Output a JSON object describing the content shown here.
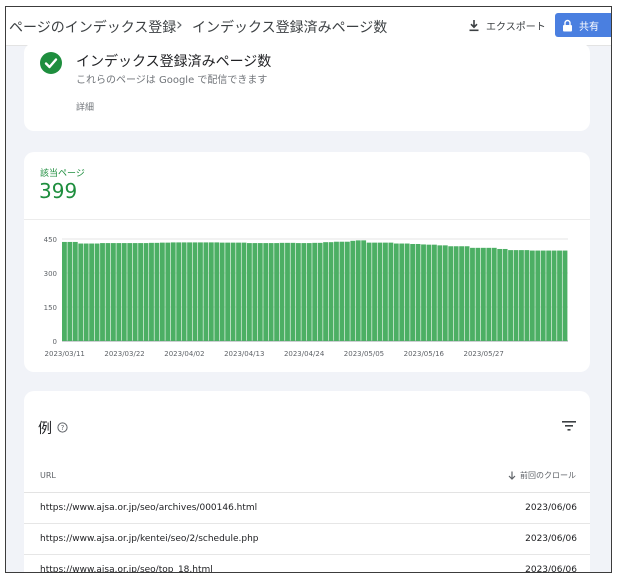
{
  "header": {
    "breadcrumb_parent": "ページのインデックス登録",
    "breadcrumb_separator": "›",
    "breadcrumb_current": "インデックス登録済みページ数",
    "export_label": "エクスポート",
    "share_label": "共有"
  },
  "status_card": {
    "title": "インデックス登録済みページ数",
    "subtitle": "これらのページは Google で配信できます",
    "details_link": "詳細"
  },
  "summary": {
    "label": "該当ページ",
    "value": "399"
  },
  "chart_data": {
    "type": "bar",
    "title": "",
    "xlabel": "",
    "ylabel": "",
    "ylim": [
      0,
      450
    ],
    "yticks": [
      0,
      150,
      300,
      450
    ],
    "ytick_labels": [
      "0",
      "150",
      "300",
      "450"
    ],
    "xtick_labels": [
      "2023/03/11",
      "2023/03/22",
      "2023/04/02",
      "2023/04/13",
      "2023/04/24",
      "2023/05/05",
      "2023/05/16",
      "2023/05/27"
    ],
    "color": "#4caf64",
    "values": [
      437,
      437,
      437,
      430,
      430,
      430,
      430,
      432,
      432,
      432,
      432,
      432,
      432,
      432,
      432,
      432,
      433,
      433,
      434,
      434,
      435,
      435,
      435,
      435,
      435,
      435,
      435,
      435,
      435,
      434,
      434,
      434,
      434,
      434,
      432,
      432,
      432,
      432,
      432,
      432,
      433,
      433,
      433,
      432,
      432,
      432,
      433,
      433,
      436,
      436,
      438,
      438,
      438,
      442,
      444,
      444,
      434,
      434,
      434,
      434,
      434,
      430,
      430,
      430,
      428,
      428,
      426,
      425,
      425,
      422,
      422,
      418,
      418,
      418,
      418,
      411,
      411,
      411,
      411,
      411,
      406,
      406,
      401,
      401,
      401,
      401,
      399,
      399,
      399,
      399,
      399,
      399,
      399
    ]
  },
  "examples": {
    "title": "例",
    "col_url": "URL",
    "col_crawl": "前回のクロール",
    "rows": [
      {
        "url": "https://www.ajsa.or.jp/seo/archives/000146.html",
        "date": "2023/06/06"
      },
      {
        "url": "https://www.ajsa.or.jp/kentei/seo/2/schedule.php",
        "date": "2023/06/06"
      },
      {
        "url": "https://www.ajsa.or.jp/seo/top_18.html",
        "date": "2023/06/06"
      }
    ]
  }
}
